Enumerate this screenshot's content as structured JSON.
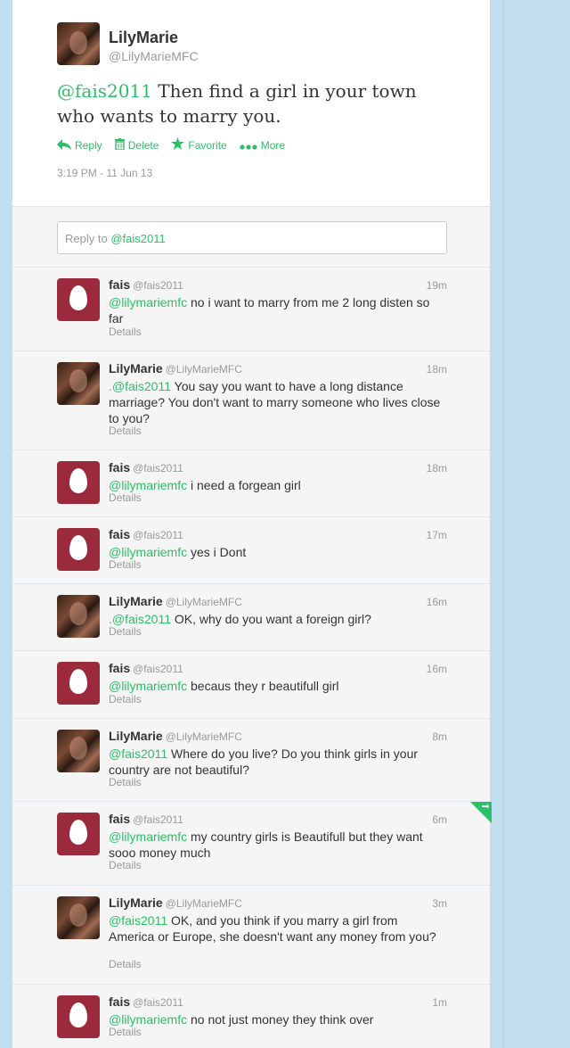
{
  "main_tweet": {
    "name": "LilyMarie",
    "handle": "@LilyMarieMFC",
    "mention": "@fais2011",
    "text": " Then find a girl in your town who wants to marry you.",
    "timestamp": "3:19 PM - 11 Jun 13",
    "actions": {
      "reply": "Reply",
      "delete": "Delete",
      "favorite": "Favorite",
      "more": "More"
    }
  },
  "reply_box": {
    "prefix": "Reply to ",
    "mention": "@fais2011"
  },
  "tweets": [
    {
      "name": "fais",
      "handle": "@fais2011",
      "time": "19m",
      "mention": "@lilymariemfc",
      "text": " no i want to marry from me 2 long disten so far",
      "details": "Details",
      "avatar": "egg"
    },
    {
      "name": "LilyMarie",
      "handle": "@LilyMarieMFC",
      "time": "18m",
      "mention": ".@fais2011",
      "text": " You say you want to have a long distance marriage? You don't want to marry someone who lives close to you?",
      "details": "Details",
      "avatar": "photo"
    },
    {
      "name": "fais",
      "handle": "@fais2011",
      "time": "18m",
      "mention": "@lilymariemfc",
      "text": " i need a forgean girl",
      "details": "Details",
      "avatar": "egg"
    },
    {
      "name": "fais",
      "handle": "@fais2011",
      "time": "17m",
      "mention": "@lilymariemfc",
      "text": " yes i Dont",
      "details": "Details",
      "avatar": "egg"
    },
    {
      "name": "LilyMarie",
      "handle": "@LilyMarieMFC",
      "time": "16m",
      "mention": ".@fais2011",
      "text": " OK, why do you want a foreign girl?",
      "details": "Details",
      "avatar": "photo"
    },
    {
      "name": "fais",
      "handle": "@fais2011",
      "time": "16m",
      "mention": "@lilymariemfc",
      "text": "  becaus  they r beautifull girl",
      "details": "Details",
      "avatar": "egg"
    },
    {
      "name": "LilyMarie",
      "handle": "@LilyMarieMFC",
      "time": "8m",
      "mention": "@fais2011",
      "text": " Where do you live? Do you think girls in your country are not beautiful?",
      "details": "Details",
      "avatar": "photo"
    },
    {
      "name": "fais",
      "handle": "@fais2011",
      "time": "6m",
      "mention": "@lilymariemfc",
      "text": " my country girls is Beautifull but they want sooo money much",
      "details": "Details",
      "avatar": "egg"
    },
    {
      "name": "LilyMarie",
      "handle": "@LilyMarieMFC",
      "time": "3m",
      "mention": "@fais2011",
      "text": " OK, and you think if you marry a girl from America or Europe, she doesn't want any money from you?",
      "details": "Details",
      "avatar": "photo"
    },
    {
      "name": "fais",
      "handle": "@fais2011",
      "time": "1m",
      "mention": "@lilymariemfc",
      "text": " no not just money they think over",
      "details": "Details",
      "avatar": "egg"
    }
  ],
  "colors": {
    "background": "#c0deed",
    "accent": "#2bbf68",
    "egg_avatar": "#9b2a3d"
  }
}
